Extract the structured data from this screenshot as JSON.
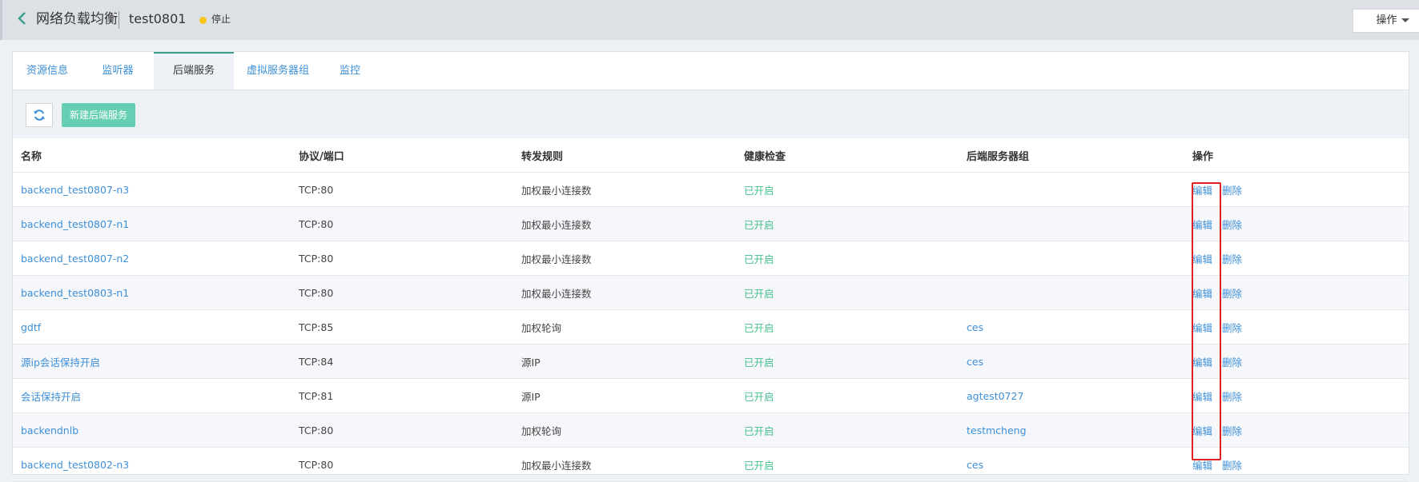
{
  "header": {
    "title": "网络负载均衡",
    "instance_name": "test0801",
    "status": "停止",
    "ops_button": "操作"
  },
  "tabs": [
    {
      "label": "资源信息"
    },
    {
      "label": "监听器"
    },
    {
      "label": "后端服务"
    },
    {
      "label": "虚拟服务器组"
    },
    {
      "label": "监控"
    }
  ],
  "toolbar": {
    "new_button": "新建后端服务"
  },
  "table": {
    "columns": [
      "名称",
      "协议/端口",
      "转发规则",
      "健康检查",
      "后端服务器组",
      "操作"
    ],
    "rows": [
      {
        "name": "backend_test0807-n3",
        "port": "TCP:80",
        "rule": "加权最小连接数",
        "health": "已开启",
        "group": "",
        "edit": "编辑",
        "delete": "删除"
      },
      {
        "name": "backend_test0807-n1",
        "port": "TCP:80",
        "rule": "加权最小连接数",
        "health": "已开启",
        "group": "",
        "edit": "编辑",
        "delete": "删除"
      },
      {
        "name": "backend_test0807-n2",
        "port": "TCP:80",
        "rule": "加权最小连接数",
        "health": "已开启",
        "group": "",
        "edit": "编辑",
        "delete": "删除"
      },
      {
        "name": "backend_test0803-n1",
        "port": "TCP:80",
        "rule": "加权最小连接数",
        "health": "已开启",
        "group": "",
        "edit": "编辑",
        "delete": "删除"
      },
      {
        "name": "gdtf",
        "port": "TCP:85",
        "rule": "加权轮询",
        "health": "已开启",
        "group": "ces",
        "edit": "编辑",
        "delete": "删除"
      },
      {
        "name": "源ip会话保持开启",
        "port": "TCP:84",
        "rule": "源IP",
        "health": "已开启",
        "group": "ces",
        "edit": "编辑",
        "delete": "删除"
      },
      {
        "name": "会话保持开启",
        "port": "TCP:81",
        "rule": "源IP",
        "health": "已开启",
        "group": "agtest0727",
        "edit": "编辑",
        "delete": "删除"
      },
      {
        "name": "backendnlb",
        "port": "TCP:80",
        "rule": "加权轮询",
        "health": "已开启",
        "group": "testmcheng",
        "edit": "编辑",
        "delete": "删除"
      },
      {
        "name": "backend_test0802-n3",
        "port": "TCP:80",
        "rule": "加权最小连接数",
        "health": "已开启",
        "group": "ces",
        "edit": "编辑",
        "delete": "删除"
      }
    ]
  },
  "colors": {
    "accent": "#3aa08a",
    "link": "#3d8fd8",
    "health_on": "#45c08c",
    "status_stopped": "#f5c518",
    "new_button": "#66cfb3",
    "highlight": "#e02020"
  },
  "icons": {
    "back": "chevron-left-icon",
    "refresh": "refresh-icon",
    "status": "status-dot-icon",
    "ops_caret": "caret-down-icon"
  }
}
